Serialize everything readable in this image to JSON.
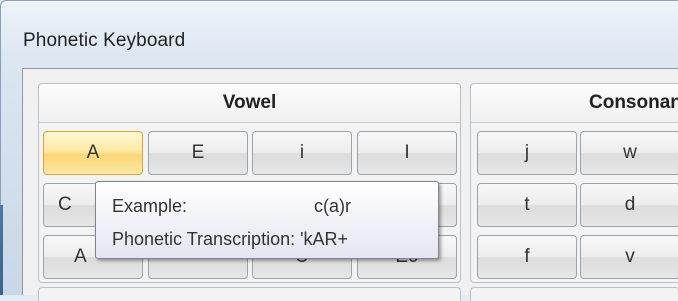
{
  "window": {
    "title": "Phonetic Keyboard"
  },
  "vowel_group": {
    "title": "Vowel",
    "row1": [
      "A",
      "E",
      "i",
      "I"
    ],
    "row2": [
      "C",
      "",
      "",
      ""
    ],
    "row3": [
      "A",
      "",
      "U",
      "E0"
    ]
  },
  "consonant_group": {
    "title": "Consonant",
    "row1": [
      "j",
      "w"
    ],
    "row2": [
      "t",
      "d"
    ],
    "row3": [
      "f",
      "v"
    ]
  },
  "tooltip": {
    "example_label": "Example:",
    "example_value": "c(a)r",
    "transcription_label": "Phonetic Transcription: 'kAR+"
  },
  "colors": {
    "selected_key": "#fbd777",
    "window_chrome": "#dbe6f1"
  }
}
